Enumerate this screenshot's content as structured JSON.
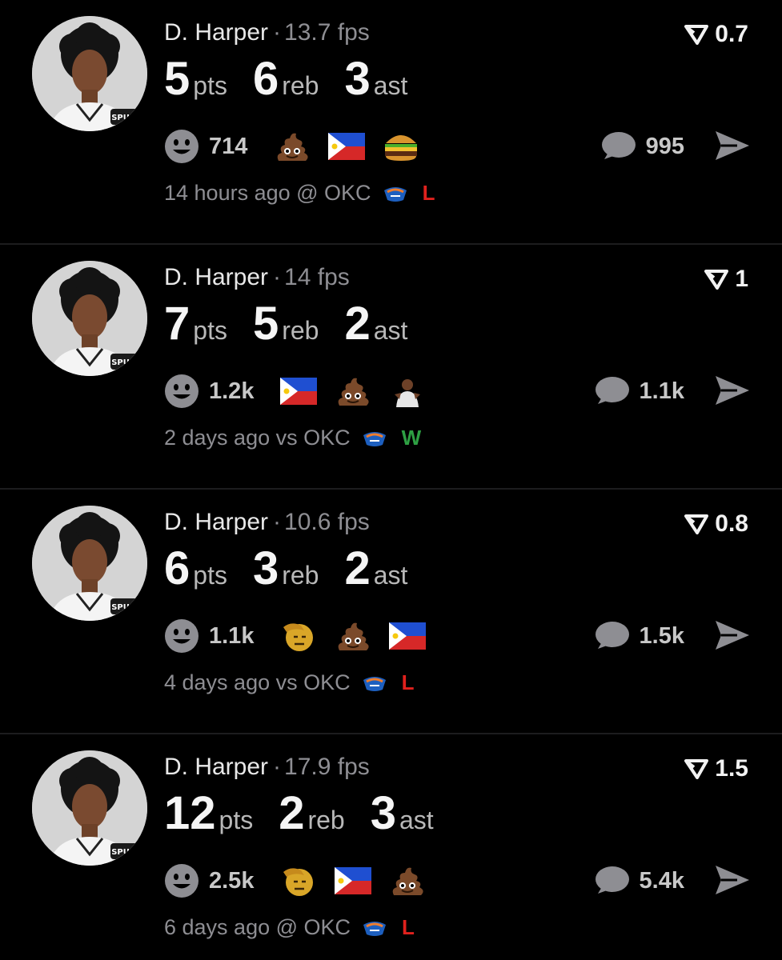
{
  "posts": [
    {
      "player": "D. Harper",
      "sep": "·",
      "fps": "13.7 fps",
      "score": "0.7",
      "pts": "5",
      "reb": "6",
      "ast": "3",
      "pts_label": "pts",
      "reb_label": "reb",
      "ast_label": "ast",
      "reaction_count": "714",
      "emojis": [
        "poop-emoji",
        "philippines-flag-emoji",
        "hamburger-emoji"
      ],
      "comment_count": "995",
      "time": "14 hours ago",
      "venue": "@ OKC",
      "opponent_logo": "okc-logo-icon",
      "result": "L",
      "result_color": "#e0211d"
    },
    {
      "player": "D. Harper",
      "sep": "·",
      "fps": "14 fps",
      "score": "1",
      "pts": "7",
      "reb": "5",
      "ast": "2",
      "pts_label": "pts",
      "reb_label": "reb",
      "ast_label": "ast",
      "reaction_count": "1.2k",
      "emojis": [
        "philippines-flag-emoji",
        "poop-emoji",
        "player-photo-emoji"
      ],
      "comment_count": "1.1k",
      "time": "2 days ago",
      "venue": "vs OKC",
      "opponent_logo": "okc-logo-icon",
      "result": "W",
      "result_color": "#2ea043"
    },
    {
      "player": "D. Harper",
      "sep": "·",
      "fps": "10.6 fps",
      "score": "0.8",
      "pts": "6",
      "reb": "3",
      "ast": "2",
      "pts_label": "pts",
      "reb_label": "reb",
      "ast_label": "ast",
      "reaction_count": "1.1k",
      "emojis": [
        "saluting-face-emoji",
        "poop-emoji",
        "philippines-flag-emoji"
      ],
      "comment_count": "1.5k",
      "time": "4 days ago",
      "venue": "vs OKC",
      "opponent_logo": "okc-logo-icon",
      "result": "L",
      "result_color": "#e0211d"
    },
    {
      "player": "D. Harper",
      "sep": "·",
      "fps": "17.9 fps",
      "score": "1.5",
      "pts": "12",
      "reb": "2",
      "ast": "3",
      "pts_label": "pts",
      "reb_label": "reb",
      "ast_label": "ast",
      "reaction_count": "2.5k",
      "emojis": [
        "saluting-face-emoji",
        "philippines-flag-emoji",
        "poop-emoji"
      ],
      "comment_count": "5.4k",
      "time": "6 days ago",
      "venue": "@ OKC",
      "opponent_logo": "okc-logo-icon",
      "result": "L",
      "result_color": "#e0211d"
    }
  ],
  "colors": {
    "background": "#000000",
    "divider": "#1c1c1e",
    "muted_text": "#8e8e93",
    "icon_gray": "#8e8e93"
  }
}
